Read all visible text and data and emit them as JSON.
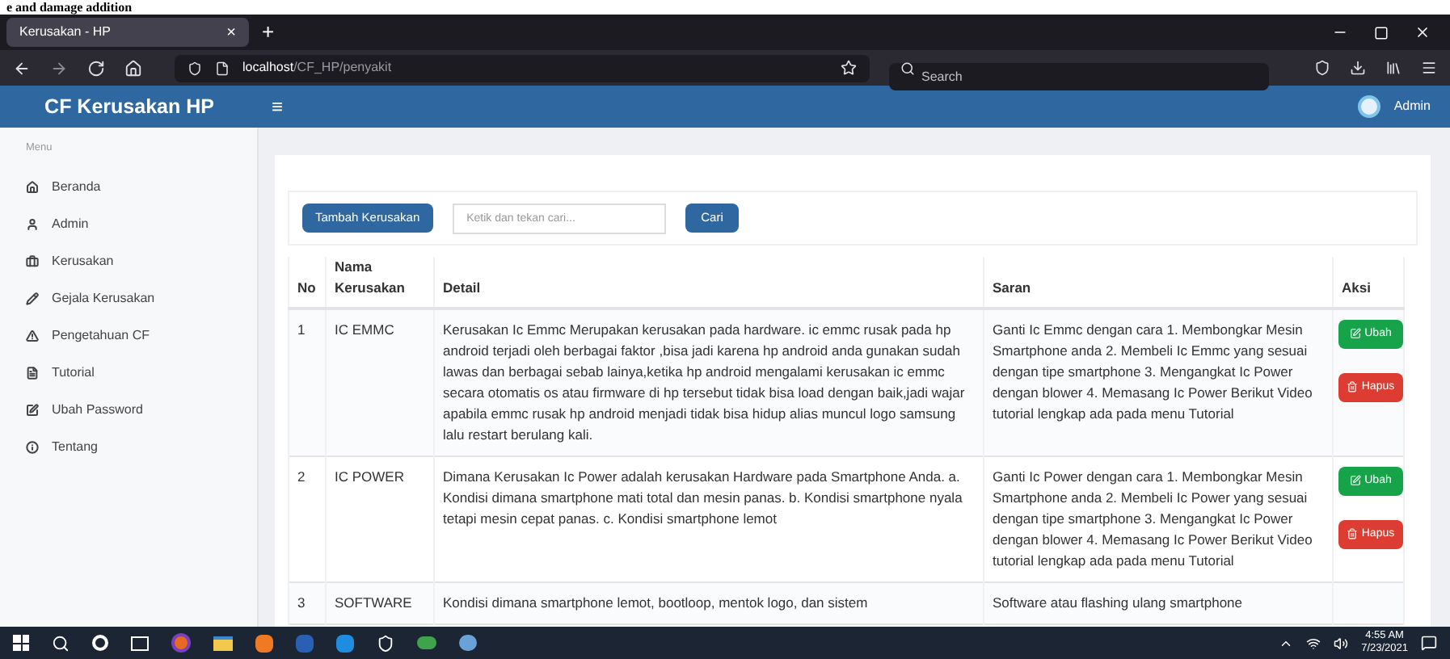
{
  "document_heading": "e and damage addition",
  "browser": {
    "tab": {
      "title": "Kerusakan - HP",
      "close": "×"
    },
    "new_tab": "+",
    "url_host": "localhost",
    "url_path": "/CF_HP/penyakit",
    "search": {
      "placeholder": "Search"
    }
  },
  "app": {
    "brand": "CF Kerusakan HP",
    "menu_toggle": "≡",
    "user": "Admin"
  },
  "sidebar": {
    "heading": "Menu",
    "items": [
      {
        "label": "Beranda",
        "selected": false
      },
      {
        "label": "Admin",
        "selected": false
      },
      {
        "label": "Kerusakan",
        "selected": false
      },
      {
        "label": "Gejala Kerusakan",
        "selected": false
      },
      {
        "label": "Pengetahuan CF",
        "selected": false
      },
      {
        "label": "Tutorial",
        "selected": false
      },
      {
        "label": "Ubah Password",
        "selected": false
      },
      {
        "label": "Tentang",
        "selected": false
      }
    ]
  },
  "toolbar": {
    "add_button": "Tambah Kerusakan",
    "search": {
      "placeholder": "Ketik dan tekan cari..."
    },
    "search_button": "Cari"
  },
  "table": {
    "columns": [
      "No",
      "Nama Kerusakan",
      "Detail",
      "Saran",
      "Aksi"
    ],
    "rows": [
      {
        "no": "1",
        "name": "IC EMMC",
        "detail": "Kerusakan Ic Emmc Merupakan kerusakan pada hardware. ic emmc rusak pada hp android terjadi oleh berbagai faktor ,bisa jadi karena hp android anda gunakan sudah lawas dan berbagai sebab lainya,ketika hp android mengalami kerusakan ic emmc secara otomatis os atau firmware di hp tersebut tidak bisa load dengan baik,jadi wajar apabila emmc rusak hp android menjadi tidak bisa hidup alias muncul logo samsung lalu restart berulang kali.",
        "advice": "Ganti Ic Emmc dengan cara 1. Membongkar Mesin Smartphone anda 2. Membeli Ic Emmc yang sesuai dengan tipe smartphone 3. Mengangkat Ic Power dengan blower 4. Memasang Ic Power Berikut Video tutorial lengkap ada pada menu Tutorial",
        "actions": [
          {
            "kind": "edit",
            "label": "Ubah"
          },
          {
            "kind": "delete",
            "label": "Hapus"
          }
        ]
      },
      {
        "no": "2",
        "name": "IC POWER",
        "detail": "Dimana Kerusakan Ic Power adalah kerusakan Hardware pada Smartphone Anda. a. Kondisi dimana smartphone mati total dan mesin panas. b. Kondisi smartphone nyala tetapi mesin cepat panas. c. Kondisi smartphone lemot",
        "advice": "Ganti Ic Power dengan cara 1. Membongkar Mesin Smartphone anda 2. Membeli Ic Power yang sesuai dengan tipe smartphone 3. Mengangkat Ic Power dengan blower 4. Memasang Ic Power Berikut Video tutorial lengkap ada pada menu Tutorial",
        "actions": [
          {
            "kind": "edit",
            "label": "Ubah"
          },
          {
            "kind": "delete",
            "label": "Hapus"
          }
        ]
      },
      {
        "no": "3",
        "name": "SOFTWARE",
        "detail": "Kondisi dimana smartphone lemot, bootloop, mentok logo, dan sistem",
        "advice": "Software atau flashing ulang smartphone",
        "actions": []
      }
    ]
  },
  "taskbar": {
    "time": "4:55 AM",
    "date": "7/23/2021"
  }
}
